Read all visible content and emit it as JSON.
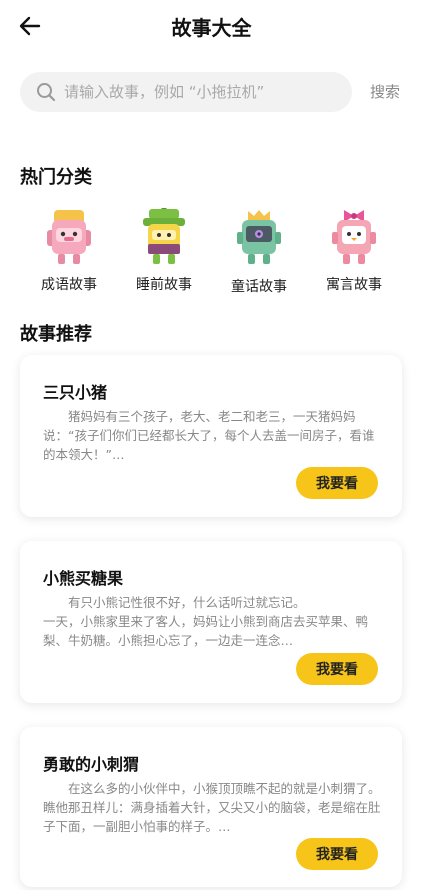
{
  "header": {
    "title": "故事大全",
    "back_icon": "arrow-left-icon"
  },
  "search": {
    "placeholder": "请输入故事，例如 “小拖拉机”",
    "button_label": "搜索",
    "icon": "search-icon"
  },
  "categories": {
    "title": "热门分类",
    "items": [
      {
        "label": "成语故事",
        "icon": "pink-block-character-icon"
      },
      {
        "label": "睡前故事",
        "icon": "green-hat-block-character-icon"
      },
      {
        "label": "童话故事",
        "icon": "green-crown-block-character-icon"
      },
      {
        "label": "寓言故事",
        "icon": "bow-block-character-icon"
      }
    ]
  },
  "recommend": {
    "title": "故事推荐",
    "stories": [
      {
        "title": "三只小猪",
        "summary": "猪妈妈有三个孩子，老大、老二和老三，一天猪妈妈说：“孩子们你们已经都长大了，每个人去盖一间房子，看谁的本领大！”…",
        "button": "我要看"
      },
      {
        "title": "小熊买糖果",
        "summary": "有只小熊记性很不好，什么话听过就忘记。\n一天，小熊家里来了客人，妈妈让小熊到商店去买苹果、鸭梨、牛奶糖。小熊担心忘了，一边走一连念…",
        "button": "我要看"
      },
      {
        "title": "勇敢的小刺猬",
        "summary": "在这么多的小伙伴中，小猴顶顶瞧不起的就是小刺猬了。瞧他那丑样儿：满身插着大针，又尖又小的脑袋，老是缩在肚子下面，一副胆小怕事的样子。…",
        "button": "我要看"
      }
    ]
  },
  "colors": {
    "accent": "#f7c51a",
    "search_bg": "#f2f2f2",
    "muted_text": "#888888"
  }
}
